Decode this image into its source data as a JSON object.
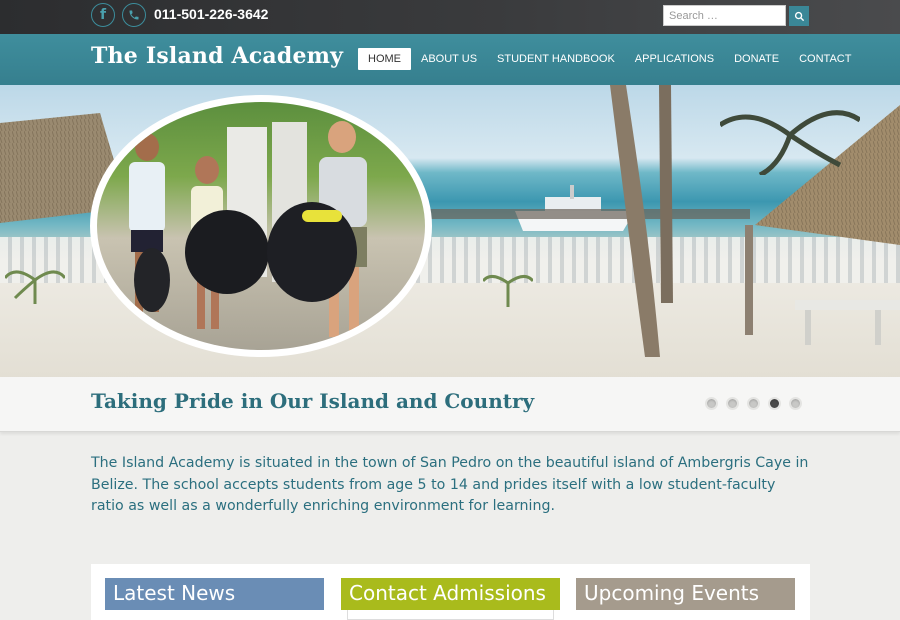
{
  "topbar": {
    "phone": "011-501-226-3642",
    "search_placeholder": "Search …",
    "social_icons": [
      "facebook-icon",
      "phone-icon"
    ]
  },
  "navbar": {
    "brand": "The Island Academy",
    "items": [
      {
        "label": "HOME",
        "active": true
      },
      {
        "label": "ABOUT US",
        "active": false
      },
      {
        "label": "STUDENT HANDBOOK",
        "active": false
      },
      {
        "label": "APPLICATIONS",
        "active": false
      },
      {
        "label": "DONATE",
        "active": false
      },
      {
        "label": "CONTACT",
        "active": false
      }
    ]
  },
  "slider": {
    "caption": "Taking Pride in Our Island and Country",
    "slide_count": 5,
    "active_slide": 4
  },
  "intro": {
    "text": "The Island Academy is situated in the town of San Pedro on the beautiful island of Ambergris Caye in Belize. The school accepts students from age 5 to 14 and prides itself with a low student-faculty ratio as well as a wonderfully enriching environment for learning."
  },
  "boxes": [
    {
      "title": "Latest News",
      "color": "#6a8db5"
    },
    {
      "title": "Contact Admissions",
      "color": "#a9bb1c"
    },
    {
      "title": "Upcoming Events",
      "color": "#a59b8d"
    }
  ],
  "colors": {
    "brand_teal": "#3f8e9d",
    "text_teal": "#2b6f7f"
  }
}
